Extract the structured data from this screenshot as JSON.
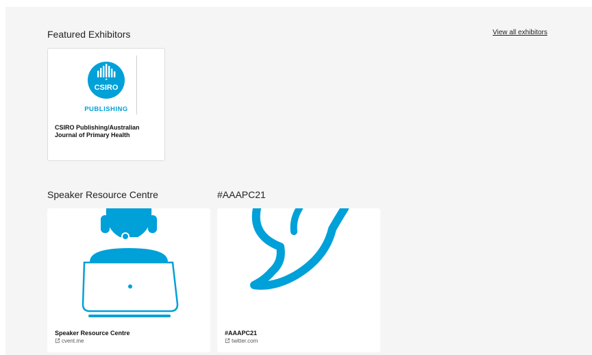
{
  "featured": {
    "title": "Featured Exhibitors",
    "view_all_label": "View all exhibitors",
    "exhibitors": [
      {
        "name": "CSIRO Publishing/Australian Journal of Primary Health",
        "logo_text": "CSIRO",
        "logo_subtext": "PUBLISHING"
      }
    ]
  },
  "resources": {
    "speaker": {
      "section_title": "Speaker Resource Centre",
      "card_title": "Speaker Resource Centre",
      "link": "cvent.me"
    },
    "twitter": {
      "section_title": "#AAAPC21",
      "card_title": "#AAAPC21",
      "link": "twitter.com"
    }
  },
  "colors": {
    "brand": "#00a0d8",
    "panel": "#f5f5f5"
  },
  "icons": {
    "external": "external-link-icon",
    "speaker_art": "headset-person-laptop-icon",
    "twitter_art": "twitter-bird-icon"
  }
}
